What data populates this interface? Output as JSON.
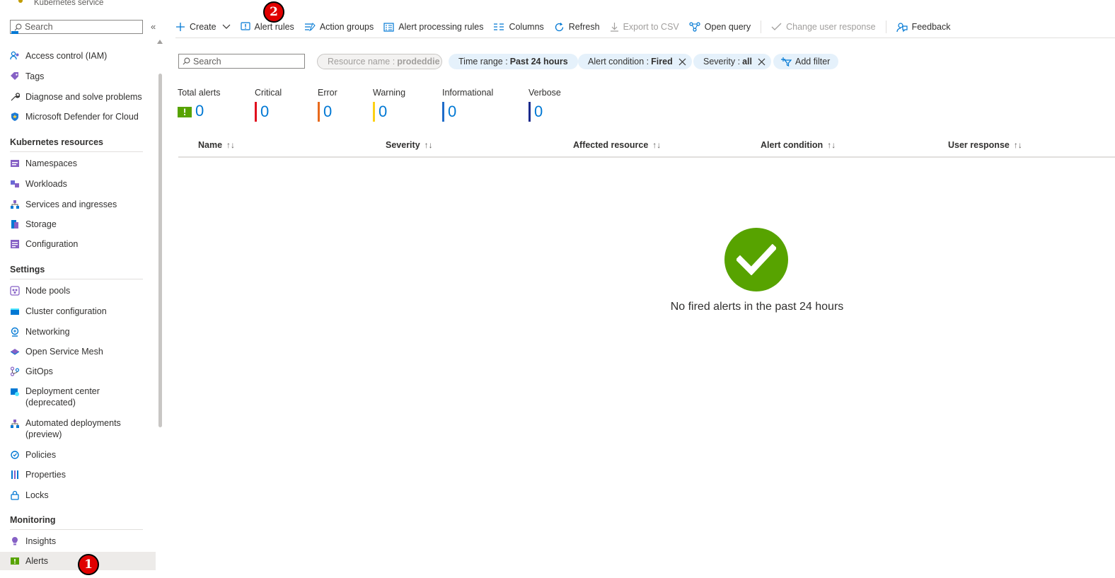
{
  "brand": {
    "subtitle": "Kubernetes service"
  },
  "sidebar": {
    "search_placeholder": "Search",
    "collapse_glyph": "«",
    "items_top": [
      {
        "label": "Access control (IAM)",
        "icon": "people-icon"
      },
      {
        "label": "Tags",
        "icon": "tag-icon"
      },
      {
        "label": "Diagnose and solve problems",
        "icon": "wrench-icon"
      },
      {
        "label": "Microsoft Defender for Cloud",
        "icon": "shield-icon"
      }
    ],
    "sections": [
      {
        "title": "Kubernetes resources",
        "items": [
          {
            "label": "Namespaces",
            "icon": "namespace-icon"
          },
          {
            "label": "Workloads",
            "icon": "workloads-icon"
          },
          {
            "label": "Services and ingresses",
            "icon": "network-icon"
          },
          {
            "label": "Storage",
            "icon": "storage-icon"
          },
          {
            "label": "Configuration",
            "icon": "configuration-icon"
          }
        ]
      },
      {
        "title": "Settings",
        "items": [
          {
            "label": "Node pools",
            "icon": "node-pools-icon"
          },
          {
            "label": "Cluster configuration",
            "icon": "cluster-config-icon"
          },
          {
            "label": "Networking",
            "icon": "networking-icon"
          },
          {
            "label": "Open Service Mesh",
            "icon": "mesh-icon"
          },
          {
            "label": "GitOps",
            "icon": "gitops-icon"
          },
          {
            "label": "Deployment center",
            "label2": "(deprecated)",
            "icon": "deployment-icon"
          },
          {
            "label": "Automated deployments",
            "label2": "(preview)",
            "icon": "automated-deploy-icon"
          },
          {
            "label": "Policies",
            "icon": "policies-icon"
          },
          {
            "label": "Properties",
            "icon": "properties-icon"
          },
          {
            "label": "Locks",
            "icon": "lock-icon"
          }
        ]
      },
      {
        "title": "Monitoring",
        "items": [
          {
            "label": "Insights",
            "icon": "insights-icon"
          },
          {
            "label": "Alerts",
            "icon": "alerts-icon",
            "active": true
          }
        ]
      }
    ]
  },
  "annotations": {
    "one": "1",
    "two": "2"
  },
  "toolbar": {
    "create": "Create",
    "alert_rules": "Alert rules",
    "action_groups": "Action groups",
    "alert_processing_rules": "Alert processing rules",
    "columns": "Columns",
    "refresh": "Refresh",
    "export_csv": "Export to CSV",
    "open_query": "Open query",
    "change_user_response": "Change user response",
    "feedback": "Feedback"
  },
  "filters": {
    "search_placeholder": "Search",
    "resource_name_key": "Resource name :",
    "resource_name_value": "prodeddie",
    "time_range_key": "Time range :",
    "time_range_value": "Past 24 hours",
    "alert_condition_key": "Alert condition :",
    "alert_condition_value": "Fired",
    "severity_key": "Severity :",
    "severity_value": "all",
    "add_filter": "Add filter"
  },
  "summary": [
    {
      "label": "Total alerts",
      "value": "0",
      "color": "#57a300"
    },
    {
      "label": "Critical",
      "value": "0",
      "color": "#e00b1c"
    },
    {
      "label": "Error",
      "value": "0",
      "color": "#e86a1c"
    },
    {
      "label": "Warning",
      "value": "0",
      "color": "#fcd116"
    },
    {
      "label": "Informational",
      "value": "0",
      "color": "#1f6cc9"
    },
    {
      "label": "Verbose",
      "value": "0",
      "color": "#1b2a8c"
    }
  ],
  "table": {
    "columns": [
      "Name",
      "Severity",
      "Affected resource",
      "Alert condition",
      "User response"
    ],
    "sort_glyph": "↑↓"
  },
  "empty_state": {
    "message": "No fired alerts in the past 24 hours"
  }
}
